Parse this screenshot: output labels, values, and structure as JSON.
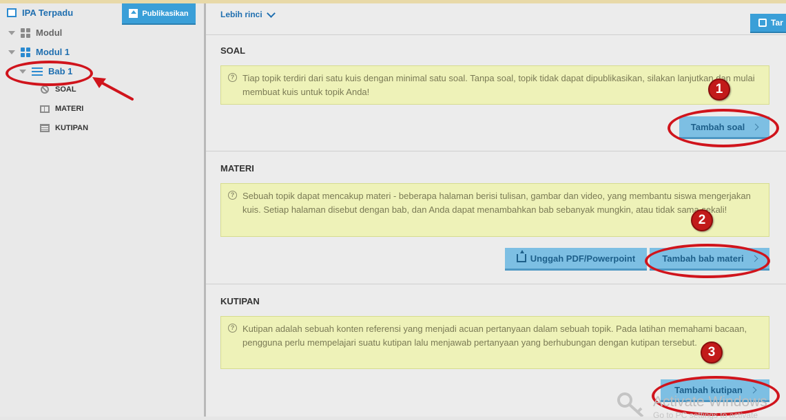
{
  "sidebar": {
    "root_title": "IPA Terpadu",
    "publish_label": "Publikasikan",
    "items": [
      {
        "label": "Modul"
      },
      {
        "label": "Modul 1"
      },
      {
        "label": "Bab 1"
      }
    ],
    "sub_items": [
      {
        "label": "SOAL",
        "icon": "no-entry-icon"
      },
      {
        "label": "MATERI",
        "icon": "book-icon"
      },
      {
        "label": "KUTIPAN",
        "icon": "newspaper-icon"
      }
    ]
  },
  "header": {
    "detail_link": "Lebih rinci",
    "top_right_button": "Tar"
  },
  "sections": [
    {
      "title": "SOAL",
      "note": "Tiap topik terdiri dari satu kuis dengan minimal satu soal. Tanpa soal, topik tidak dapat dipublikasikan, silakan lanjutkan dan mulai membuat kuis untuk topik Anda!",
      "buttons": [
        "Tambah soal"
      ],
      "badge": "1"
    },
    {
      "title": "MATERI",
      "note": "Sebuah topik dapat mencakup materi - beberapa halaman berisi tulisan, gambar dan video, yang membantu siswa mengerjakan kuis. Setiap halaman disebut dengan bab, dan Anda dapat menambahkan bab sebanyak mungkin, atau tidak sama sekali!",
      "buttons": [
        "Unggah PDF/Powerpoint",
        "Tambah bab materi"
      ],
      "badge": "2"
    },
    {
      "title": "KUTIPAN",
      "note": "Kutipan adalah sebuah konten referensi yang menjadi acuan pertanyaan dalam sebuah topik. Pada latihan memahami bacaan, pengguna perlu mempelajari suatu kutipan lalu menjawab pertanyaan yang berhubungan dengan kutipan tersebut.",
      "buttons": [
        "Tambah kutipan"
      ],
      "badge": "3"
    }
  ],
  "watermark": {
    "title": "Activate Windows",
    "subtitle": "Go to PC settings to activate"
  },
  "colors": {
    "accent_blue": "#3a9fd8",
    "button_light": "#7dbfe3",
    "note_bg": "#eef2b8",
    "annotation_red": "#d0141c"
  }
}
